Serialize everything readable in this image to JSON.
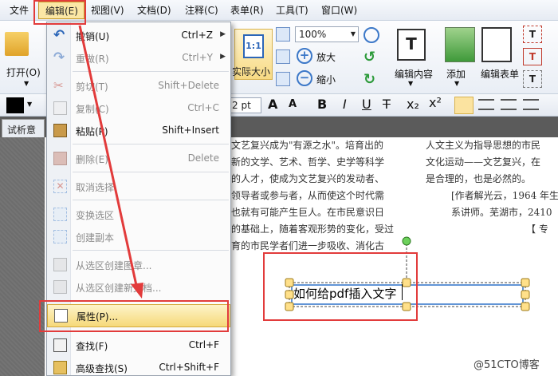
{
  "menubar": {
    "items": [
      "文件",
      "编辑(E)",
      "视图(V)",
      "文档(D)",
      "注释(C)",
      "表单(R)",
      "工具(T)",
      "窗口(W)"
    ]
  },
  "toolbar": {
    "open_label": "打开(O)",
    "actual_size_label": "实际大小",
    "actual_size_icon": "1:1",
    "zoom_value": "100%",
    "zoom_in_label": "放大",
    "zoom_out_label": "缩小",
    "edit_content_label": "编辑内容",
    "add_label": "添加",
    "edit_form_label": "编辑表单",
    "font_size_value": "2 pt"
  },
  "tab": {
    "label": "试析意"
  },
  "document": {
    "col1": [
      "文艺复兴成为\"有源之水\"。培育出的",
      "新的文学、艺术、哲学、史学等科学",
      "的人才，使成为文艺复兴的发动者、",
      "领导者或参与者，从而使这个时代需",
      "也就有可能产生巨人。在市民意识日",
      "的基础上，随着客观形势的变化，受过",
      "育的市民学者们进一步吸收、消化古"
    ],
    "col2": [
      "人文主义为指导思想的市民",
      "文化运动——文艺复兴，在",
      "是合理的，也是必然的。",
      "[作者解光云，1964 年生",
      "系讲师。芜湖市，2410",
      "【 专"
    ],
    "textbox": "如何给pdf插入文字"
  },
  "dropdown": {
    "items": [
      {
        "label": "撤销(U)",
        "shortcut": "Ctrl+Z"
      },
      {
        "label": "重做(R)",
        "shortcut": "Ctrl+Y"
      },
      {
        "label": "剪切(T)",
        "shortcut": "Shift+Delete"
      },
      {
        "label": "复制(C)",
        "shortcut": "Ctrl+C"
      },
      {
        "label": "粘贴(P)",
        "shortcut": "Shift+Insert"
      },
      {
        "label": "删除(E)",
        "shortcut": "Delete"
      },
      {
        "label": "取消选择",
        "shortcut": ""
      },
      {
        "label": "变换选区",
        "shortcut": ""
      },
      {
        "label": "创建副本",
        "shortcut": ""
      },
      {
        "label": "从选区创建图章...",
        "shortcut": ""
      },
      {
        "label": "从选区创建新文档...",
        "shortcut": ""
      },
      {
        "label": "属性(P)...",
        "shortcut": ""
      },
      {
        "label": "查找(F)",
        "shortcut": "Ctrl+F"
      },
      {
        "label": "高级查找(S)",
        "shortcut": "Ctrl+Shift+F"
      }
    ]
  },
  "watermark": "@51CTO博客",
  "colors": {
    "highlight_red": "#e23b3b",
    "menu_highlight": "#fbe7a5",
    "selection_blue": "#2f72c9"
  }
}
